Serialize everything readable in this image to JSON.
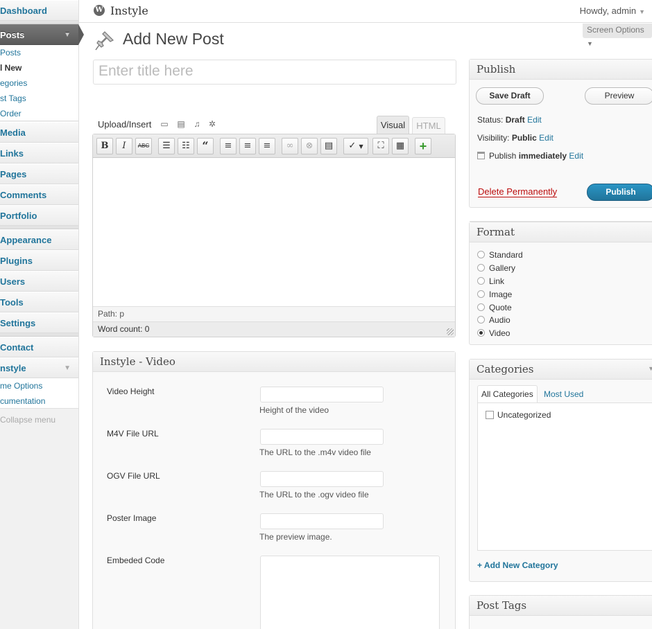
{
  "sidebar": {
    "dashboard": "Dashboard",
    "posts": "Posts",
    "posts_sub": [
      "Posts",
      "l New",
      "egories",
      "st Tags",
      "Order"
    ],
    "menu": [
      "Media",
      "Links",
      "Pages",
      "Comments",
      "Portfolio"
    ],
    "menu2": [
      "Appearance",
      "Plugins",
      "Users",
      "Tools",
      "Settings"
    ],
    "contact": "Contact",
    "instyle": "nstyle",
    "instyle_sub": [
      "me Options",
      "cumentation"
    ],
    "collapse": "Collapse menu"
  },
  "header": {
    "site_name": "Instyle",
    "greeting": "Howdy, admin",
    "screen_options": "Screen Options"
  },
  "page": {
    "title": "Add New Post",
    "title_placeholder": "Enter title here"
  },
  "editor": {
    "upload_insert": "Upload/Insert",
    "tab_visual": "Visual",
    "tab_html": "HTML",
    "path": "Path: p",
    "word_count": "Word count: 0",
    "buttons": {
      "bold": "B",
      "italic": "I",
      "strike": "ABC"
    }
  },
  "video_box": {
    "title": "Instyle - Video",
    "fields": [
      {
        "label": "Video Height",
        "desc": "Height of the video"
      },
      {
        "label": "M4V File URL",
        "desc": "The URL to the .m4v video file"
      },
      {
        "label": "OGV File URL",
        "desc": "The URL to the .ogv video file"
      },
      {
        "label": "Poster Image",
        "desc": "The preview image."
      },
      {
        "label": "Embeded Code",
        "desc": ""
      }
    ]
  },
  "publish": {
    "title": "Publish",
    "save_draft": "Save Draft",
    "preview": "Preview",
    "status_label": "Status:",
    "status_value": "Draft",
    "visibility_label": "Visibility:",
    "visibility_value": "Public",
    "publish_label": "Publish",
    "publish_value": "immediately",
    "edit": "Edit",
    "delete": "Delete Permanently",
    "publish_button": "Publish"
  },
  "format": {
    "title": "Format",
    "options": [
      "Standard",
      "Gallery",
      "Link",
      "Image",
      "Quote",
      "Audio",
      "Video"
    ],
    "selected": "Video"
  },
  "categories": {
    "title": "Categories",
    "tab_all": "All Categories",
    "tab_most_used": "Most Used",
    "items": [
      "Uncategorized"
    ],
    "add_new": "+ Add New Category"
  },
  "tags": {
    "title": "Post Tags"
  },
  "colors": {
    "link": "#21759b",
    "primary": "#21759b",
    "delete": "#bc0b0b"
  }
}
